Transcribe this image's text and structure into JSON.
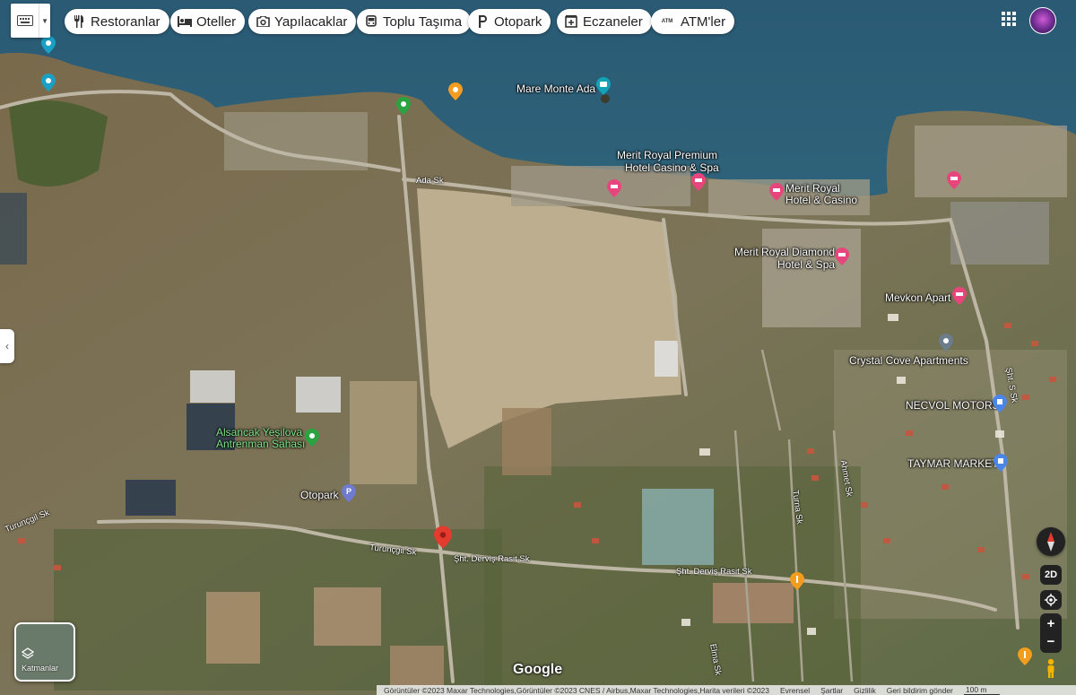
{
  "toolbar": {
    "chips": [
      {
        "id": "restaurants",
        "label": "Restoranlar",
        "icon": "fork-knife-icon"
      },
      {
        "id": "hotels",
        "label": "Oteller",
        "icon": "bed-icon"
      },
      {
        "id": "things",
        "label": "Yapılacaklar",
        "icon": "camera-icon"
      },
      {
        "id": "transit",
        "label": "Toplu Taşıma",
        "icon": "bus-icon"
      },
      {
        "id": "parking",
        "label": "Otopark",
        "icon": "parking-icon"
      },
      {
        "id": "pharmacy",
        "label": "Eczaneler",
        "icon": "pharmacy-icon"
      },
      {
        "id": "atm",
        "label": "ATM'ler",
        "icon": "atm-icon"
      }
    ],
    "atm_icon_text": "ATM"
  },
  "places": {
    "mare_monte": "Mare Monte Ada",
    "merit_premium_1": "Merit Royal Premium",
    "merit_premium_2": "Hotel Casino & Spa",
    "merit_royal_1": "Merit Royal",
    "merit_royal_2": "Hotel & Casino",
    "merit_diamond_1": "Merit Royal Diamond",
    "merit_diamond_2": "Hotel & Spa",
    "mevkon": "Mevkon Apart",
    "crystal": "Crystal Cove Apartments",
    "necvol": "NECVOL MOTORS",
    "taymar": "TAYMAR MARKET",
    "alsancak_1": "Alsancak Yeşilova",
    "alsancak_2": "Antrenman Sahası",
    "otopark": "Otopark"
  },
  "streets": {
    "ada": "Ada Sk",
    "turuncgil_1": "Turunçgil Sk",
    "turuncgil_2": "Turunçgil Sk",
    "dervis_1": "Şht. Derviş Rasit Sk",
    "dervis_2": "Şht. Derviş Rasit Sk",
    "ahmet": "Ahmet Sk",
    "turna": "Turna Sk",
    "sht_s": "Şht. S Sk",
    "elma": "Elma Sk"
  },
  "controls": {
    "layers_label": "Katmanlar",
    "two_d": "2D",
    "zoom_in": "+",
    "zoom_out": "−"
  },
  "branding": {
    "google": "Google"
  },
  "footer": {
    "imagery": "Görüntüler ©2023 Maxar Technologies,Görüntüler ©2023 CNES / Airbus,Maxar Technologies,Harita verileri ©2023",
    "region": "Evrensel",
    "terms": "Şartlar",
    "privacy": "Gizlilik",
    "feedback": "Geri bildirim gönder",
    "scale": "100 m"
  },
  "colors": {
    "sea": "#2f5f77",
    "land": "#6e6b4b",
    "hotel_pin": "#e8457c",
    "place_pin": "#2aa38e",
    "red_pin": "#e33b2e",
    "orange_pin": "#f29d1d"
  }
}
